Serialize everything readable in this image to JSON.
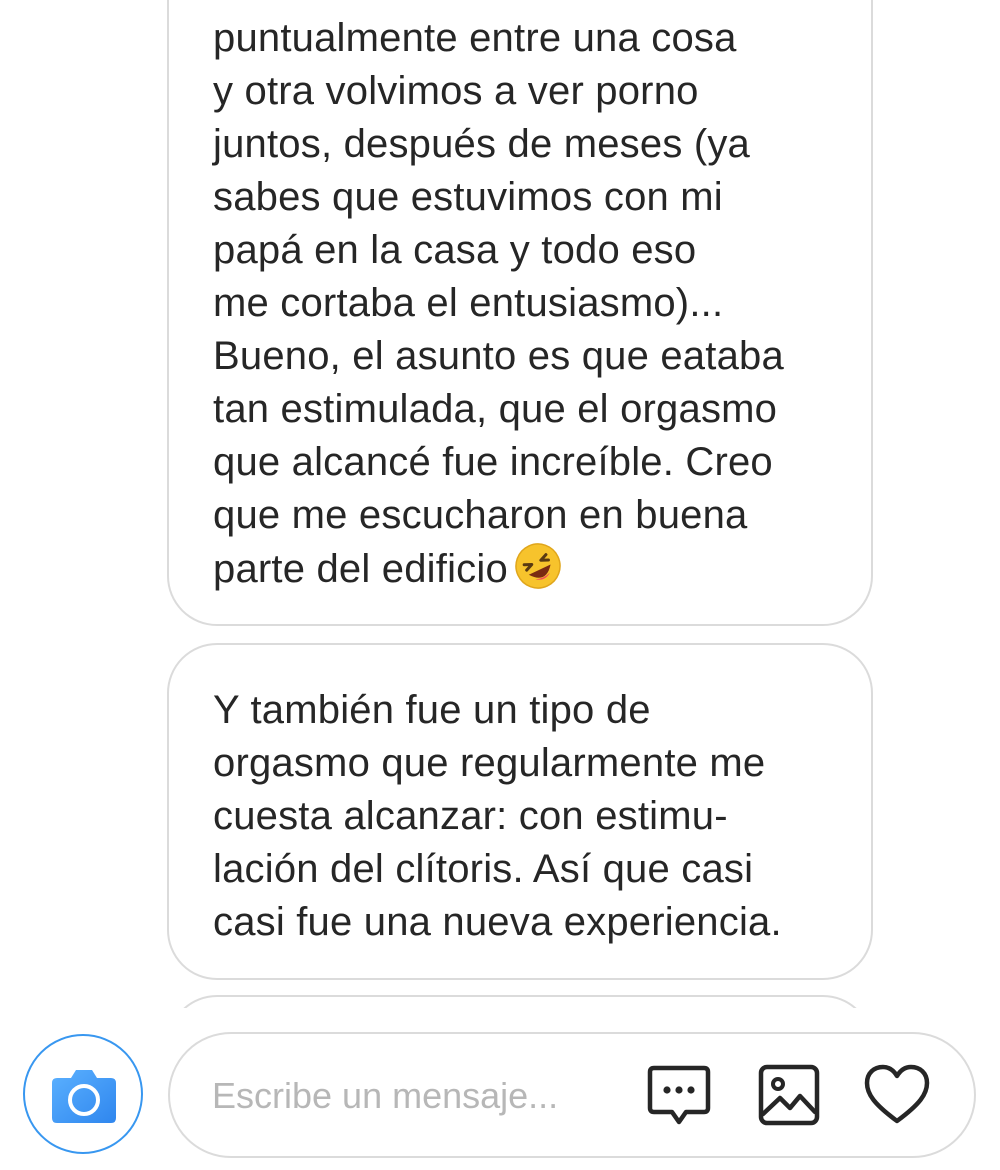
{
  "messages": [
    {
      "text": "puntualmente entre una cosa\ny otra volvimos a ver porno\njuntos, después de meses (ya\nsabes que estuvimos con mi\npapá en la casa y todo eso\nme cortaba el entusiasmo)...\nBueno, el asunto es que eataba\ntan estimulada, que el orgasmo\nque alcancé fue increíble. Creo\nque me escucharon en buena\nparte del edificio",
      "emoji": "rolling-on-the-floor-laughing-emoji"
    },
    {
      "text": "Y también fue un tipo de\norgasmo que regularmente me\ncuesta alcanzar: con estimu-\nlación del clítoris. Así que casi\ncasi fue una nueva experiencia."
    }
  ],
  "composer": {
    "placeholder": "Escribe un mensaje...",
    "value": "",
    "icons": {
      "camera": "camera-icon",
      "chat": "speech-bubble-icon",
      "gallery": "image-gallery-icon",
      "like": "heart-icon"
    },
    "accent_color": "#3897f0"
  }
}
